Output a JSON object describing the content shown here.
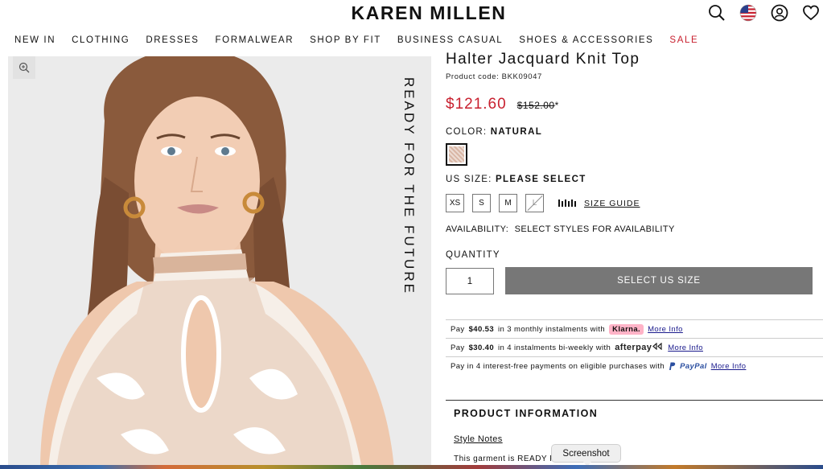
{
  "header": {
    "logo": "KAREN MILLEN",
    "icons": [
      "search-icon",
      "us-flag-icon",
      "account-icon",
      "wishlist-heart-icon"
    ]
  },
  "nav": {
    "items": [
      "NEW IN",
      "CLOTHING",
      "DRESSES",
      "FORMALWEAR",
      "SHOP BY FIT",
      "BUSINESS CASUAL",
      "SHOES & ACCESSORIES",
      "SALE"
    ],
    "sale_color": "#c8202f"
  },
  "image": {
    "overlay_text": "READY FOR THE FUTURE",
    "zoom_icon": "zoom-in-icon"
  },
  "product": {
    "title": "Halter Jacquard Knit Top",
    "code_label": "Product code: BKK09047",
    "price_now": "$121.60",
    "price_old": "$152.00",
    "price_old_suffix": "*",
    "price_color": "#c8202f"
  },
  "color": {
    "label": "COLOR:",
    "value": "NATURAL",
    "swatch_color": "#d9b6a5"
  },
  "size": {
    "label": "US SIZE:",
    "value": "PLEASE SELECT",
    "options": [
      "XS",
      "S",
      "M",
      "L"
    ],
    "guide_label": "SIZE GUIDE",
    "guide_icon": "ruler-icon"
  },
  "availability": {
    "label": "AVAILABILITY:",
    "value": "SELECT STYLES FOR AVAILABILITY"
  },
  "quantity": {
    "label": "QUANTITY",
    "value": "1"
  },
  "cta": {
    "label": "SELECT US SIZE",
    "color": "#777777"
  },
  "payments": {
    "klarna": {
      "prefix": "Pay",
      "amount": "$40.53",
      "text": "in 3 monthly instalments with",
      "brand": "Klarna.",
      "more": "More Info"
    },
    "afterpay": {
      "prefix": "Pay",
      "amount": "$30.40",
      "text": "in 4 instalments bi-weekly with",
      "brand": "afterpay",
      "more": "More Info"
    },
    "paypal": {
      "text": "Pay in 4 interest-free payments on eligible purchases with",
      "brand": "PayPal",
      "more": "More Info"
    }
  },
  "product_info": {
    "heading": "PRODUCT INFORMATION",
    "style_notes": "Style Notes",
    "garment_text": "This garment is READY F"
  },
  "tooltip": {
    "label": "Screenshot"
  }
}
